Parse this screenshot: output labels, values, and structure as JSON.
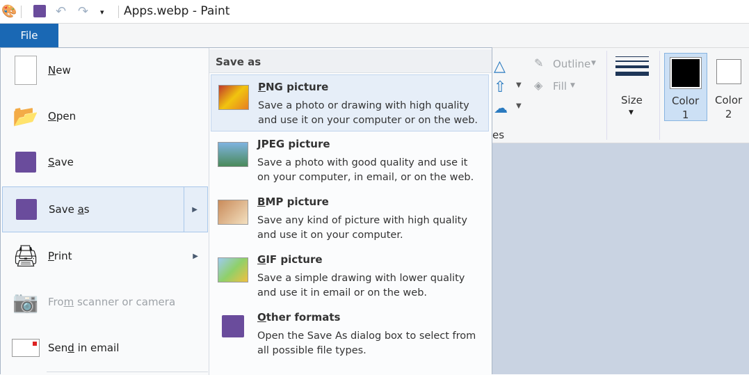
{
  "window": {
    "title": "Apps.webp - Paint"
  },
  "file_tab": "File",
  "ribbon": {
    "outline": "Outline",
    "fill": "Fill",
    "shapes_partial": "es",
    "size": "Size",
    "color1": "Color",
    "color1_num": "1",
    "color2": "Color",
    "color2_num": "2",
    "color1_value": "#000000",
    "color2_value": "#ffffff"
  },
  "menu": {
    "items": [
      {
        "pre": "",
        "key": "N",
        "post": "ew",
        "icon": "new-document-icon"
      },
      {
        "pre": "",
        "key": "O",
        "post": "pen",
        "icon": "open-folder-icon"
      },
      {
        "pre": "",
        "key": "S",
        "post": "ave",
        "icon": "save-icon"
      },
      {
        "pre": "Save ",
        "key": "a",
        "post": "s",
        "icon": "save-as-icon"
      },
      {
        "pre": "",
        "key": "P",
        "post": "rint",
        "icon": "printer-icon"
      },
      {
        "pre": "Fro",
        "key": "m",
        "post": " scanner or camera",
        "icon": "scanner-icon"
      },
      {
        "pre": "Sen",
        "key": "d",
        "post": " in email",
        "icon": "email-icon"
      }
    ],
    "submenu_title": "Save as",
    "formats": [
      {
        "key": "P",
        "title": "NG picture",
        "desc": "Save a photo or drawing with high quality and use it on your computer or on the web."
      },
      {
        "key": "J",
        "title": "PEG picture",
        "desc": "Save a photo with good quality and use it on your computer, in email, or on the web."
      },
      {
        "key": "B",
        "title": "MP picture",
        "desc": "Save any kind of picture with high quality and use it on your computer."
      },
      {
        "key": "G",
        "title": "IF picture",
        "desc": "Save a simple drawing with lower quality and use it in email or on the web."
      },
      {
        "key": "O",
        "title": "ther formats",
        "desc": "Open the Save As dialog box to select from all possible file types."
      }
    ]
  }
}
